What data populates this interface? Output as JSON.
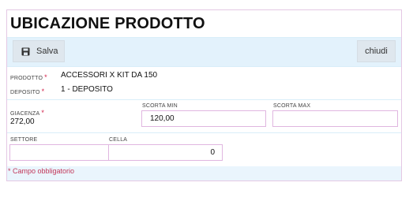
{
  "title": "UBICAZIONE PRODOTTO",
  "toolbar": {
    "save_label": "Salva",
    "close_label": "chiudi"
  },
  "fields": {
    "prodotto": {
      "label": "PRODOTTO",
      "value": "ACCESSORI X KIT DA 150"
    },
    "deposito": {
      "label": "DEPOSITO",
      "value": "1 - DEPOSITO"
    },
    "giacenza": {
      "label": "GIACENZA",
      "value": "272,00"
    },
    "scorta_min": {
      "label": "SCORTA MIN",
      "value": "120,00"
    },
    "scorta_max": {
      "label": "SCORTA MAX",
      "value": ""
    },
    "settore": {
      "label": "SETTORE",
      "value": ""
    },
    "cella": {
      "label": "CELLA",
      "value": "0"
    }
  },
  "required_mark": "*",
  "footer_note": "* Campo obbligatorio",
  "icons": {
    "save": "floppy-disk-icon"
  },
  "colors": {
    "required": "#d2224a",
    "field_border": "#e0b6e0",
    "panel_bg": "#eaf5fd"
  }
}
